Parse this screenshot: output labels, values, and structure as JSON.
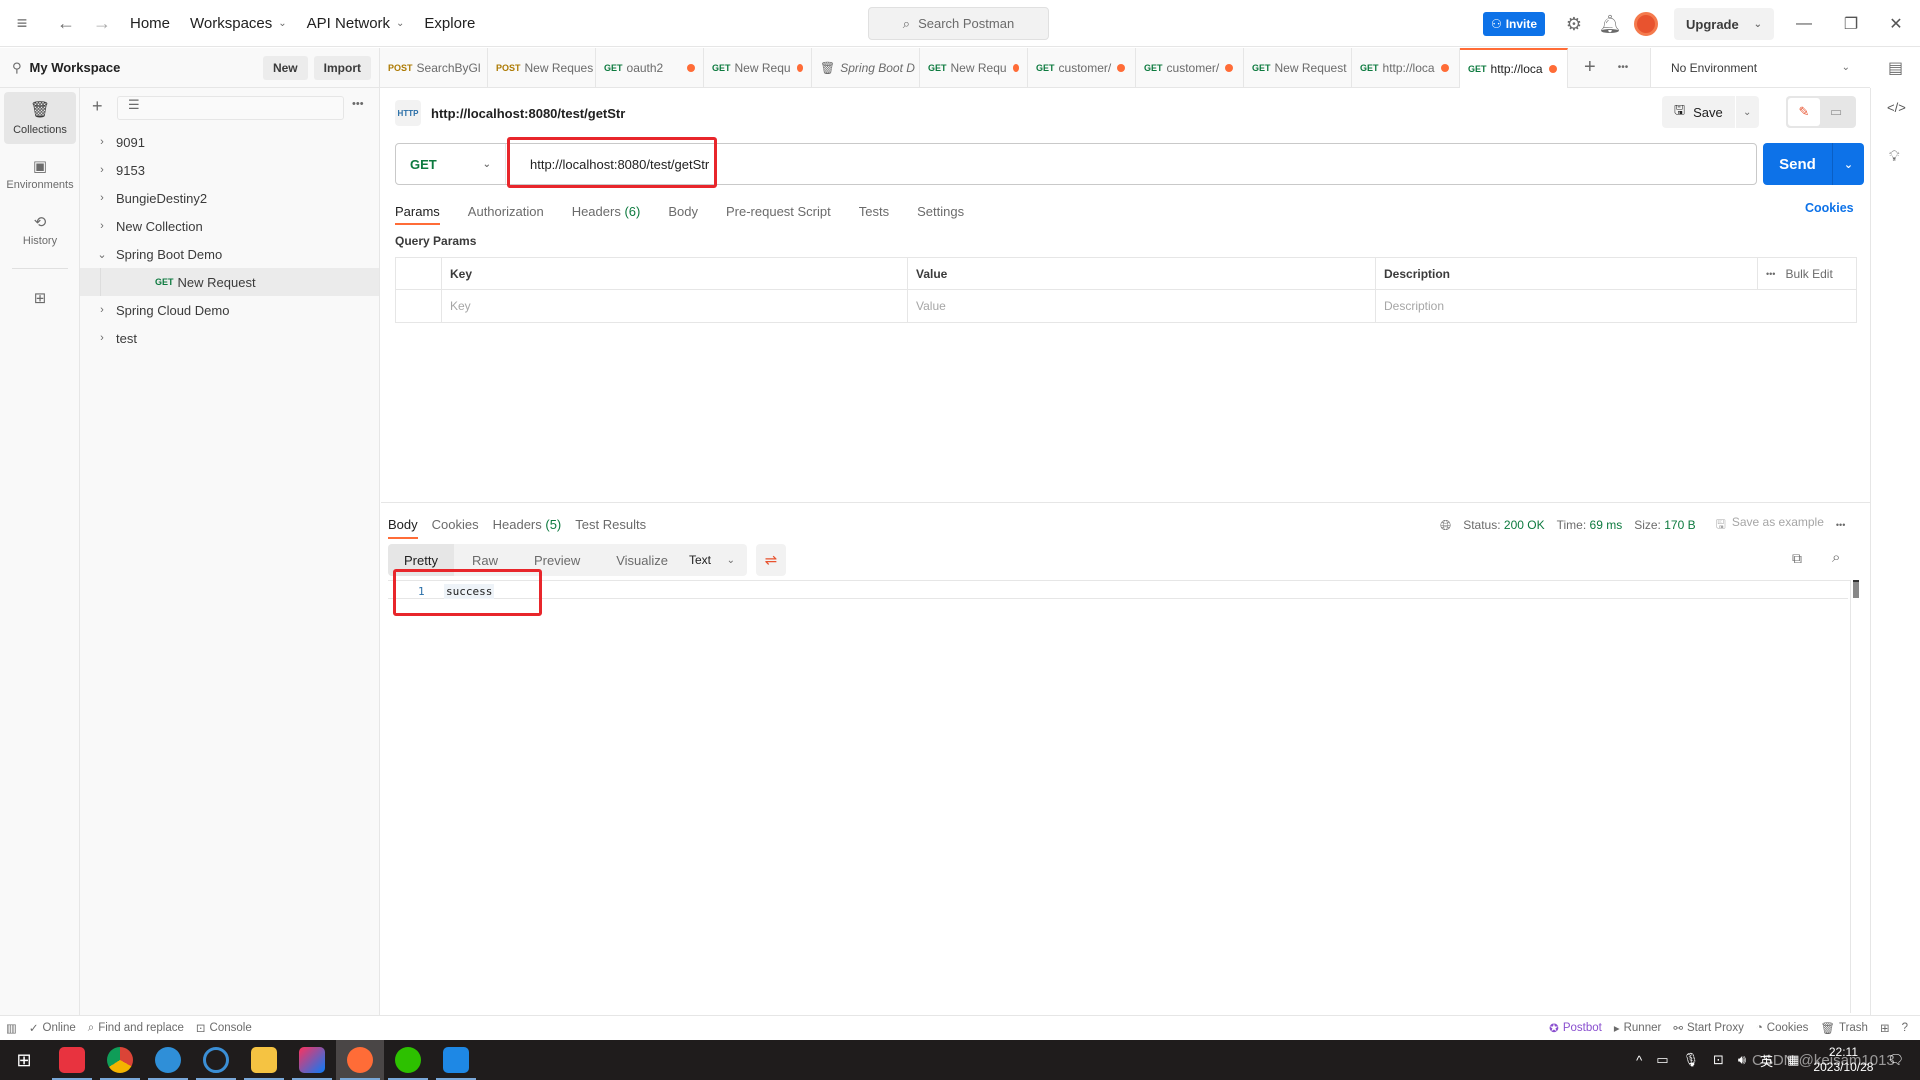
{
  "topbar": {
    "nav": [
      "Home",
      "Workspaces",
      "API Network",
      "Explore"
    ],
    "search_placeholder": "Search Postman",
    "invite": "Invite",
    "upgrade": "Upgrade"
  },
  "workspace": {
    "title": "My Workspace",
    "new_btn": "New",
    "import_btn": "Import"
  },
  "left_rail": [
    {
      "label": "Collections",
      "icon": "collections-icon",
      "active": true
    },
    {
      "label": "Environments",
      "icon": "environments-icon"
    },
    {
      "label": "History",
      "icon": "history-icon"
    }
  ],
  "collections": [
    {
      "label": "9091",
      "expanded": false
    },
    {
      "label": "9153",
      "expanded": false
    },
    {
      "label": "BungieDestiny2",
      "expanded": false
    },
    {
      "label": "New Collection",
      "expanded": false
    },
    {
      "label": "Spring Boot Demo",
      "expanded": true
    },
    {
      "label": "New Request",
      "method": "GET",
      "child": true,
      "selected": true
    },
    {
      "label": "Spring Cloud Demo",
      "expanded": false
    },
    {
      "label": "test",
      "expanded": false
    }
  ],
  "tabs": [
    {
      "method": "POST",
      "label": "SearchByGl",
      "dot": false
    },
    {
      "method": "POST",
      "label": "New Reques",
      "dot": false
    },
    {
      "method": "GET",
      "label": "oauth2",
      "dot": true
    },
    {
      "method": "GET",
      "label": "New Requ",
      "dot": true
    },
    {
      "method": "",
      "label": "Spring Boot D",
      "dot": false,
      "italic": true
    },
    {
      "method": "GET",
      "label": "New Requ",
      "dot": true
    },
    {
      "method": "GET",
      "label": "customer/",
      "dot": true
    },
    {
      "method": "GET",
      "label": "customer/",
      "dot": true
    },
    {
      "method": "GET",
      "label": "New Request",
      "dot": false
    },
    {
      "method": "GET",
      "label": "http://loca",
      "dot": true
    },
    {
      "method": "GET",
      "label": "http://loca",
      "dot": true,
      "active": true
    }
  ],
  "environment": "No Environment",
  "request": {
    "title": "http://localhost:8080/test/getStr",
    "method": "GET",
    "url": "http://localhost:8080/test/getStr",
    "save": "Save",
    "send": "Send",
    "tabs": {
      "params": "Params",
      "authorization": "Authorization",
      "headers": "Headers",
      "headers_count": "(6)",
      "body": "Body",
      "prerequest": "Pre-request Script",
      "tests": "Tests",
      "settings": "Settings"
    },
    "cookies": "Cookies",
    "query_params_label": "Query Params",
    "table": {
      "headers": [
        "Key",
        "Value",
        "Description"
      ],
      "placeholders": [
        "Key",
        "Value",
        "Description"
      ],
      "bulk_edit": "Bulk Edit"
    }
  },
  "response": {
    "tabs": {
      "body": "Body",
      "cookies": "Cookies",
      "headers": "Headers",
      "headers_count": "(5)",
      "test_results": "Test Results"
    },
    "status_label": "Status:",
    "status": "200 OK",
    "time_label": "Time:",
    "time": "69 ms",
    "size_label": "Size:",
    "size": "170 B",
    "save_example": "Save as example",
    "views": [
      "Pretty",
      "Raw",
      "Preview",
      "Visualize"
    ],
    "format": "Text",
    "lines": [
      {
        "num": "1",
        "text": "success"
      }
    ]
  },
  "footer": {
    "online": "Online",
    "find_replace": "Find and replace",
    "console": "Console",
    "postbot": "Postbot",
    "runner": "Runner",
    "start_proxy": "Start Proxy",
    "cookies": "Cookies",
    "trash": "Trash"
  },
  "taskbar": {
    "time": "22:11",
    "date": "2023/10/28",
    "ime": "英",
    "watermark": "CSDN @keisam1013"
  },
  "colors": {
    "accent": "#ff6c37",
    "primary": "#0d72e8",
    "get": "#0d7a3f",
    "post": "#ad7a03",
    "highlight": "#e8262b"
  }
}
